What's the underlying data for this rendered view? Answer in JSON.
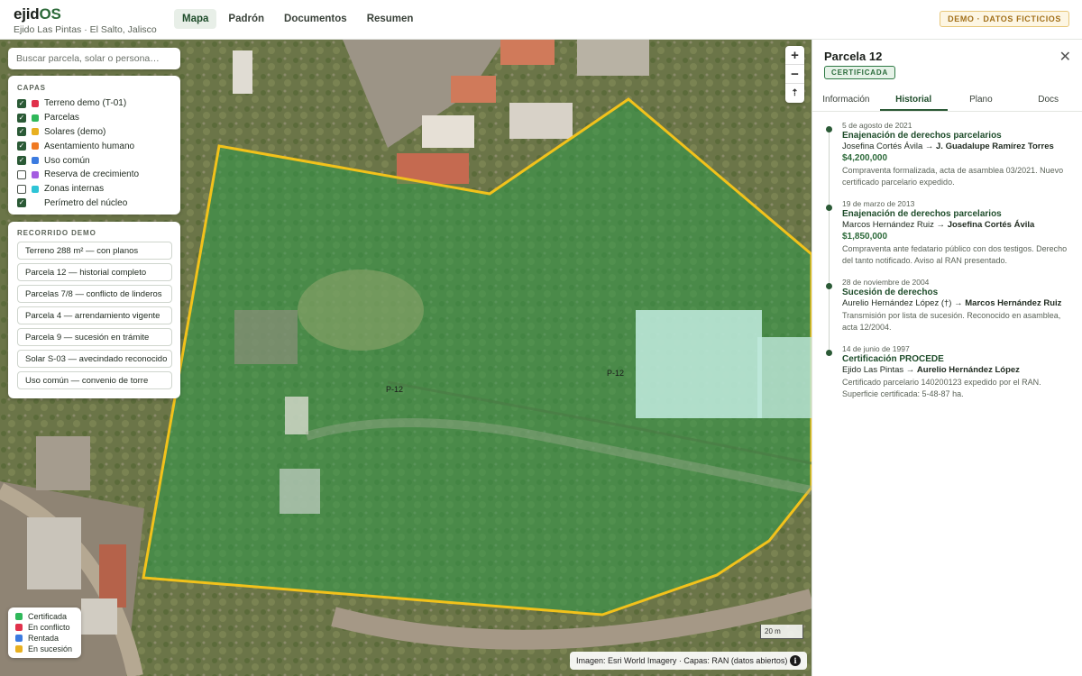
{
  "brand": {
    "name_main": "ejid",
    "name_accent": "OS",
    "subtitle": "Ejido Las Pintas · El Salto, Jalisco"
  },
  "nav": {
    "items": [
      "Mapa",
      "Padrón",
      "Documentos",
      "Resumen"
    ],
    "active": "Mapa"
  },
  "demo_badge": "DEMO · DATOS FICTICIOS",
  "search": {
    "placeholder": "Buscar parcela, solar o persona…"
  },
  "layers": {
    "title": "CAPAS",
    "items": [
      {
        "label": "Terreno demo (T-01)",
        "checked": true,
        "color": "#e0314b"
      },
      {
        "label": "Parcelas",
        "checked": true,
        "color": "#2fb85a"
      },
      {
        "label": "Solares (demo)",
        "checked": true,
        "color": "#e8b020"
      },
      {
        "label": "Asentamiento humano",
        "checked": true,
        "color": "#f07a22"
      },
      {
        "label": "Uso común",
        "checked": true,
        "color": "#3b7be0"
      },
      {
        "label": "Reserva de crecimiento",
        "checked": false,
        "color": "#a45de0"
      },
      {
        "label": "Zonas internas",
        "checked": false,
        "color": "#2ec4d6"
      },
      {
        "label": "Perímetro del núcleo",
        "checked": true,
        "color": ""
      }
    ]
  },
  "tour": {
    "title": "RECORRIDO DEMO",
    "items": [
      "Terreno 288 m² — con planos",
      "Parcela 12 — historial completo",
      "Parcelas 7/8 — conflicto de linderos",
      "Parcela 4 — arrendamiento vigente",
      "Parcela 9 — sucesión en trámite",
      "Solar S-03 — avecindado reconocido",
      "Uso común — convenio de torre"
    ]
  },
  "map": {
    "zoom_in": "+",
    "zoom_out": "−",
    "reset": "⇡",
    "parcel_labels": [
      "P-12",
      "P-12"
    ],
    "scale": "20 m",
    "attribution": "Imagen: Esri World Imagery · Capas: RAN (datos abiertos)",
    "info": "i"
  },
  "legend": {
    "items": [
      {
        "label": "Certificada",
        "color": "#2fb85a"
      },
      {
        "label": "En conflicto",
        "color": "#e0314b"
      },
      {
        "label": "Rentada",
        "color": "#3b7be0"
      },
      {
        "label": "En sucesión",
        "color": "#e8b020"
      }
    ]
  },
  "side": {
    "title": "Parcela 12",
    "status": "CERTIFICADA",
    "close": "✕",
    "tabs": [
      "Información",
      "Historial",
      "Plano",
      "Docs"
    ],
    "active_tab": "Historial",
    "events": [
      {
        "date": "5 de agosto de 2021",
        "title": "Enajenación de derechos parcelarios",
        "from": "Josefina Cortés Ávila",
        "arrow": "→",
        "to": "J. Guadalupe Ramírez Torres",
        "amount": "$4,200,000",
        "note": "Compraventa formalizada, acta de asamblea 03/2021. Nuevo certificado parcelario expedido."
      },
      {
        "date": "19 de marzo de 2013",
        "title": "Enajenación de derechos parcelarios",
        "from": "Marcos Hernández Ruiz",
        "arrow": "→",
        "to": "Josefina Cortés Ávila",
        "amount": "$1,850,000",
        "note": "Compraventa ante fedatario público con dos testigos. Derecho del tanto notificado. Aviso al RAN presentado."
      },
      {
        "date": "28 de noviembre de 2004",
        "title": "Sucesión de derechos",
        "from": "Aurelio Hernández López (†)",
        "arrow": "→",
        "to": "Marcos Hernández Ruiz",
        "amount": "",
        "note": "Transmisión por lista de sucesión. Reconocido en asamblea, acta 12/2004."
      },
      {
        "date": "14 de junio de 1997",
        "title": "Certificación PROCEDE",
        "from": "Ejido Las Pintas",
        "arrow": "→",
        "to": "Aurelio Hernández López",
        "amount": "",
        "note": "Certificado parcelario 140200123 expedido por el RAN. Superficie certificada: 5-48-87 ha."
      }
    ]
  }
}
